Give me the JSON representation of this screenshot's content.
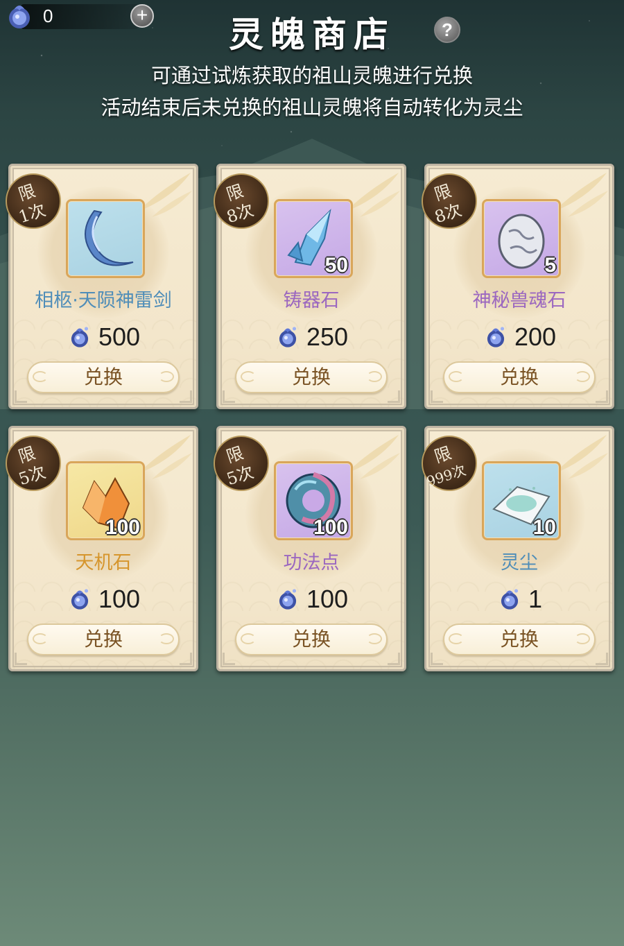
{
  "header": {
    "currency_value": "0",
    "title": "灵魄商店",
    "notice_line1": "可通过试炼获取的祖山灵魄进行兑换",
    "notice_line2": "活动结束后未兑换的祖山灵魄将自动转化为灵尘",
    "plus_symbol": "+",
    "help_symbol": "?"
  },
  "colors": {
    "name_blue": "#4f8db8",
    "name_purple": "#9b67c0",
    "name_orange": "#d6952c",
    "button_text": "#7a5324",
    "badge_brown": "#3e2917"
  },
  "items": [
    {
      "limit_top": "限",
      "limit_bottom": "1次",
      "name": "相柩·天陨神雷剑",
      "count": "",
      "price": "500",
      "button": "兑换",
      "icon": "crescent-blade-icon",
      "bg": "blue",
      "name_color": "#4f8db8"
    },
    {
      "limit_top": "限",
      "limit_bottom": "8次",
      "name": "铸器石",
      "count": "50",
      "price": "250",
      "button": "兑换",
      "icon": "crystal-shard-icon",
      "bg": "purple",
      "name_color": "#9b67c0"
    },
    {
      "limit_top": "限",
      "limit_bottom": "8次",
      "name": "神秘兽魂石",
      "count": "5",
      "price": "200",
      "button": "兑换",
      "icon": "beast-egg-icon",
      "bg": "purple",
      "name_color": "#9b67c0"
    },
    {
      "limit_top": "限",
      "limit_bottom": "5次",
      "name": "天机石",
      "count": "100",
      "price": "100",
      "button": "兑换",
      "icon": "orange-stone-icon",
      "bg": "gold",
      "name_color": "#d6952c"
    },
    {
      "limit_top": "限",
      "limit_bottom": "5次",
      "name": "功法点",
      "count": "100",
      "price": "100",
      "button": "兑换",
      "icon": "spiral-disc-icon",
      "bg": "purple",
      "name_color": "#9b67c0"
    },
    {
      "limit_top": "限",
      "limit_bottom": "999次",
      "name": "灵尘",
      "count": "10",
      "price": "1",
      "button": "兑换",
      "icon": "dust-pile-icon",
      "bg": "blue",
      "name_color": "#4f8db8"
    }
  ]
}
